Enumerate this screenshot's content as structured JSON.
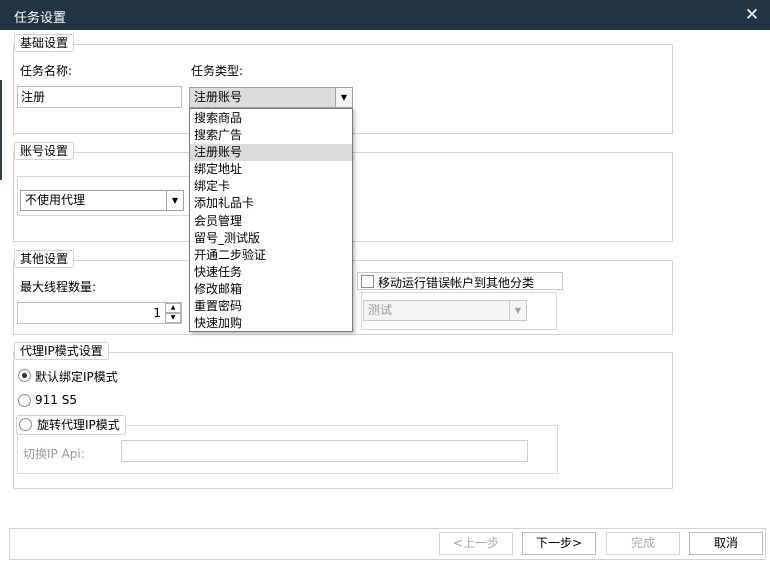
{
  "window": {
    "title": "任务设置",
    "close_glyph": "✕"
  },
  "basic": {
    "legend": "基础设置",
    "task_name_label": "任务名称:",
    "task_name_value": "注册",
    "task_type_label": "任务类型:",
    "task_type_value": "注册账号",
    "task_type_options": [
      "搜索商品",
      "搜索广告",
      "注册账号",
      "绑定地址",
      "绑定卡",
      "添加礼品卡",
      "会员管理",
      "留号_测试版",
      "开通二步验证",
      "快速任务",
      "修改邮箱",
      "重置密码",
      "快速加购"
    ],
    "selected_option": "注册账号"
  },
  "account": {
    "legend": "账号设置",
    "proxy_value": "不使用代理"
  },
  "other": {
    "legend": "其他设置",
    "max_threads_label": "最大线程数量:",
    "max_threads_value": "1",
    "move_error_label": "移动运行错误帐户到其他分类",
    "category_value": "测试"
  },
  "proxy_ip": {
    "legend": "代理IP模式设置",
    "mode_default": "默认绑定IP模式",
    "mode_911": "911 S5",
    "mode_rotate": "旋转代理IP模式",
    "switch_api_label": "切换IP Api:",
    "switch_api_value": ""
  },
  "footer": {
    "prev": "<上一步",
    "next": "下一步>",
    "finish": "完成",
    "cancel": "取消"
  },
  "colors": {
    "titlebar": "#223545",
    "selected_item": "#dcdcdc"
  }
}
